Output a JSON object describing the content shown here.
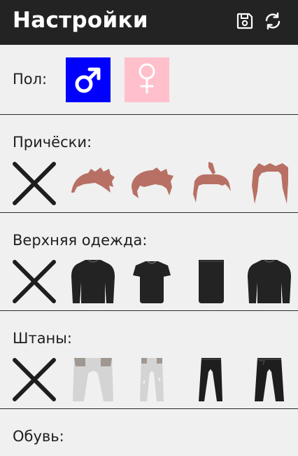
{
  "header": {
    "title": "Настройки",
    "save_icon": "floppy-disk-icon",
    "reset_icon": "refresh-icon",
    "background": "#232323"
  },
  "gender": {
    "label": "Пол:",
    "options": [
      {
        "name": "male",
        "icon": "male-symbol-icon",
        "color": "#0000ff",
        "selected": true
      },
      {
        "name": "female",
        "icon": "female-symbol-icon",
        "color": "#ffc0cb",
        "selected": false
      }
    ]
  },
  "hairstyles": {
    "label": "Причёски:",
    "items": [
      "none",
      "hair-style-1",
      "hair-style-2",
      "hair-style-3",
      "hair-style-4"
    ],
    "color": "#b87064"
  },
  "outerwear": {
    "label": "Верхняя одежда:",
    "items": [
      "none",
      "long-sleeve-shirt",
      "t-shirt",
      "tank-top",
      "jacket"
    ]
  },
  "pants": {
    "label": "Штаны:",
    "items": [
      "none",
      "light-jeans",
      "light-ripped-jeans",
      "black-pants",
      "black-jeans"
    ]
  },
  "shoes": {
    "label": "Обувь:"
  }
}
